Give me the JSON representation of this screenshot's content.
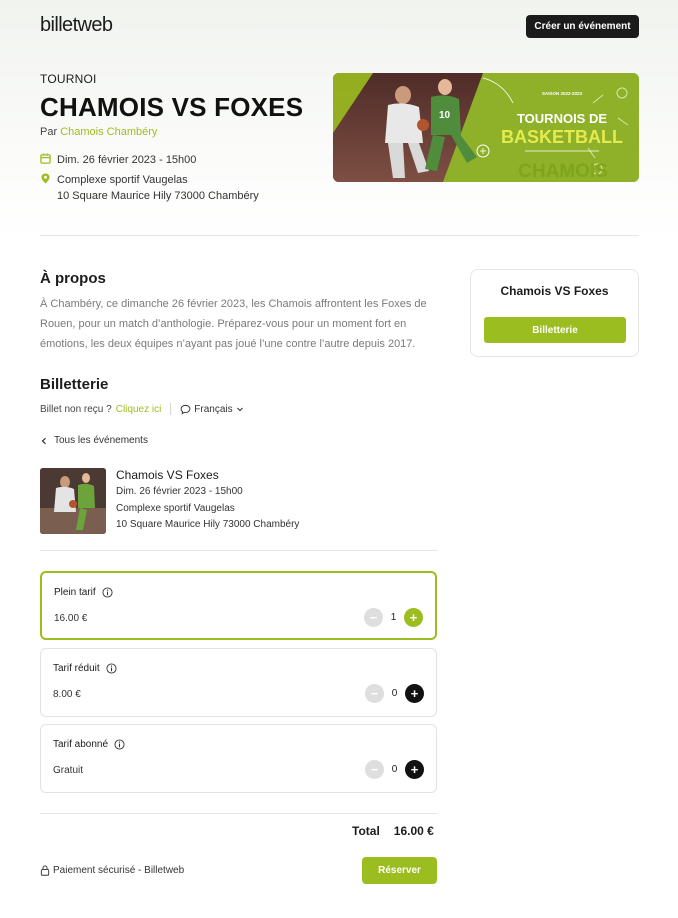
{
  "brand": {
    "logo": "billetweb",
    "accent": "#9cbd1f"
  },
  "header": {
    "create_event_label": "Créer un événement"
  },
  "event": {
    "category": "TOURNOI",
    "title": "CHAMOIS VS FOXES",
    "organizer_prefix": "Par",
    "organizer_name": "Chamois Chambéry",
    "date": "Dim. 26 février 2023 - 15h00",
    "venue": "Complexe sportif Vaugelas",
    "address": "10 Square Maurice Hily 73000 Chambéry"
  },
  "banner": {
    "season": "SAISON 2022-2023",
    "heading_line1": "TOURNOIS DE",
    "heading_line2": "BASKETBALL",
    "watermark": "CHAMOIS",
    "jersey_number": "10"
  },
  "about": {
    "title": "À propos",
    "text": "À Chambéry, ce dimanche 26 février 2023, les Chamois affrontent les Foxes de Rouen, pour un match d’anthologie. Préparez-vous pour un moment fort en émotions, les deux équipes n’ayant pas joué l’une contre l’autre depuis 2017."
  },
  "side_card": {
    "title": "Chamois VS Foxes",
    "button_label": "Billetterie"
  },
  "ticketing": {
    "title": "Billetterie",
    "not_received": "Billet non reçu ?",
    "click_here": "Cliquez ici",
    "language": "Français",
    "back_label": "Tous les événements",
    "event_name": "Chamois VS Foxes",
    "tickets": [
      {
        "name": "Plein tarif",
        "price": "16.00 €",
        "quantity": "1",
        "selected": true
      },
      {
        "name": "Tarif réduit",
        "price": "8.00 €",
        "quantity": "0",
        "selected": false
      },
      {
        "name": "Tarif abonné",
        "price": "Gratuit",
        "quantity": "0",
        "selected": false
      }
    ],
    "total_label": "Total",
    "total_value": "16.00 €",
    "secure_label": "Paiement sécurisé - Billetweb",
    "reserve_label": "Réserver"
  }
}
